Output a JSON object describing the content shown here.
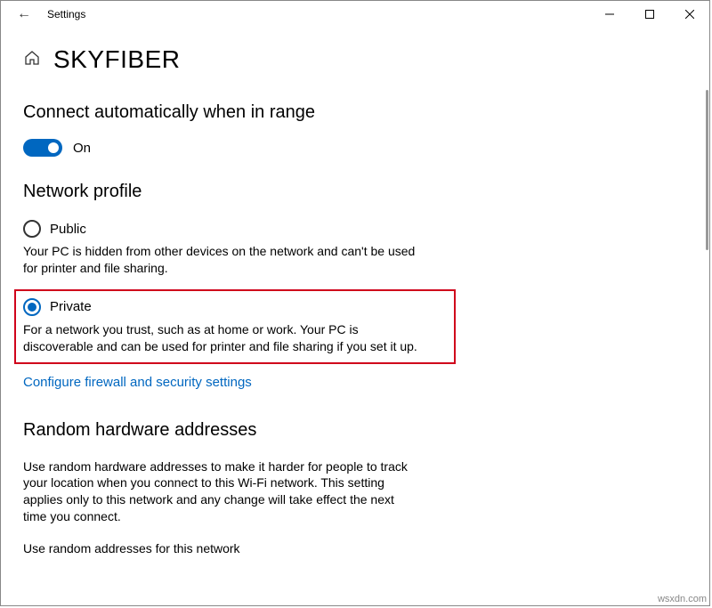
{
  "window": {
    "title": "Settings"
  },
  "page": {
    "title": "SKYFIBER"
  },
  "autoConnect": {
    "heading": "Connect automatically when in range",
    "toggleLabel": "On",
    "toggleState": true
  },
  "networkProfile": {
    "heading": "Network profile",
    "public": {
      "label": "Public",
      "desc": "Your PC is hidden from other devices on the network and can't be used for printer and file sharing.",
      "selected": false
    },
    "private": {
      "label": "Private",
      "desc": "For a network you trust, such as at home or work. Your PC is discoverable and can be used for printer and file sharing if you set it up.",
      "selected": true
    },
    "link": "Configure firewall and security settings"
  },
  "randomHw": {
    "heading": "Random hardware addresses",
    "desc": "Use random hardware addresses to make it harder for people to track your location when you connect to this Wi-Fi network. This setting applies only to this network and any change will take effect the next time you connect.",
    "fieldLabel": "Use random addresses for this network"
  },
  "watermark": "wsxdn.com"
}
